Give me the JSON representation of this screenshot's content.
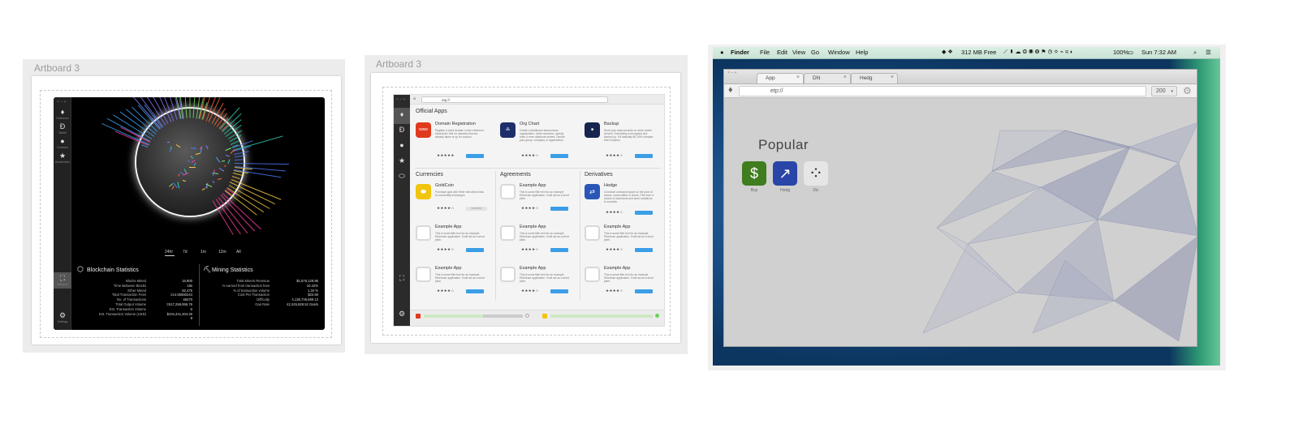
{
  "artboard1": {
    "title": "Artboard 3",
    "sidebar": [
      {
        "icon": "ethereum-icon",
        "glyph": "♦",
        "label": "Ethereum"
      },
      {
        "icon": "wallet-icon",
        "glyph": "Ð",
        "label": "Wallet"
      },
      {
        "icon": "contacts-icon",
        "glyph": "●",
        "label": "Contacts"
      },
      {
        "icon": "star-icon",
        "glyph": "★",
        "label": "Bookmarks"
      }
    ],
    "sidebar_bottom": [
      {
        "icon": "network-icon",
        "glyph": "⛶",
        "label": "Network"
      },
      {
        "icon": "gear-icon",
        "glyph": "⚙",
        "label": "Settings"
      }
    ],
    "ranges": [
      "24hr",
      "7d",
      "1m",
      "12m",
      "All"
    ],
    "blockchain": {
      "heading": "Blockchain Statistics",
      "rows": [
        {
          "label": "Blocks Mined",
          "value": "15,900"
        },
        {
          "label": "Time Between Blocks",
          "value": "18s"
        },
        {
          "label": "Ether Mined",
          "value": "82,475"
        },
        {
          "label": "Total Transaction Fees",
          "value": "Ξ14.55550244"
        },
        {
          "label": "No. of Transactions",
          "value": "48470"
        },
        {
          "label": "Total Output Volume",
          "value": "Ξ517,258,955.76"
        },
        {
          "label": "Est. Transaction Volume",
          "value": "6"
        },
        {
          "label": "Est. Transaction Volume (USD)",
          "value": "$104,441,404.26"
        },
        {
          "label": "",
          "value": "8"
        }
      ]
    },
    "mining": {
      "heading": "Mining Statistics",
      "rows": [
        {
          "label": "Total Miners Revenue",
          "value": "$1,576,128.86"
        },
        {
          "label": "% earned from transaction fees",
          "value": "10.42%"
        },
        {
          "label": "% of transaction volume",
          "value": "1.34 %"
        },
        {
          "label": "Cost Per Transaction",
          "value": "$22.69"
        },
        {
          "label": "Difficulty",
          "value": "4,138,736,689.13"
        },
        {
          "label": "Gas Rate",
          "value": "42,245,828.52 Gas/s"
        }
      ]
    }
  },
  "artboard2": {
    "title": "Artboard 3",
    "url": "etp://",
    "official_heading": "Official Apps",
    "official_apps": [
      {
        "name": "Domain Registration",
        "icon_text": "www",
        "color": "#e03a1e",
        "desc": "Register a short domain on the ethereum blockchain. Bid for domains that are already taken or up for auction.",
        "stars": "★★★★★"
      },
      {
        "name": "Org Chart",
        "icon_text": "⁂",
        "color": "#1d2f6b",
        "desc": "Create a distributed autonomous organization. Invite members, specify roles & even distribute shares. Decide your group, company or organization.",
        "stars": "★★★★☆"
      },
      {
        "name": "Backup",
        "icon_text": "■",
        "color": "#16244e",
        "desc": "Store your data securely on other nodes' servers. Everything is encrypted and backed up. It's basically 80–90% cheaper than Dropbox.",
        "stars": "★★★★☆"
      }
    ],
    "columns": [
      {
        "heading": "Currencies",
        "apps": [
          {
            "name": "GoldCoin",
            "color": "#f1c40f",
            "desc": "Purchase gold with Ether with direct links to commodity exchanges.",
            "stars": "★★★★☆",
            "button": "Installed"
          },
          {
            "name": "Example App",
            "color": "",
            "desc": "This is some filler text for an example Ethereum application. It will act as a short pitch.",
            "stars": "★★★★☆",
            "button": ""
          },
          {
            "name": "Example App",
            "color": "",
            "desc": "This is some filler text for an example Ethereum application. It will act as a short pitch.",
            "stars": "★★★★☆",
            "button": ""
          }
        ]
      },
      {
        "heading": "Agreements",
        "apps": [
          {
            "name": "Example App",
            "color": "",
            "desc": "This is some filler text for an example Ethereum application. It will act as a short pitch.",
            "stars": "★★★★☆",
            "button": ""
          },
          {
            "name": "Example App",
            "color": "",
            "desc": "This is some filler text for an example Ethereum application. It will act as a short pitch.",
            "stars": "★★★★☆",
            "button": ""
          },
          {
            "name": "Example App",
            "color": "",
            "desc": "This is some filler text for an example Ethereum application. It will act as a short pitch.",
            "stars": "★★★★☆",
            "button": ""
          }
        ]
      },
      {
        "heading": "Derivatives",
        "apps": [
          {
            "name": "Hedge",
            "color": "#2a56b8",
            "desc": "Construct contracts based on the price of stocks, commodities & bonds. Pick from a choice of data feeds and send invitations to contacts.",
            "stars": "★★★★☆",
            "button": ""
          },
          {
            "name": "Example App",
            "color": "",
            "desc": "This is some filler text for an example Ethereum application. It will act as a short pitch.",
            "stars": "★★★★☆",
            "button": ""
          },
          {
            "name": "Example App",
            "color": "",
            "desc": "This is some filler text for an example Ethereum application. It will act as a short pitch.",
            "stars": "★★★★☆",
            "button": ""
          }
        ]
      }
    ]
  },
  "artboard3": {
    "menubar": {
      "apple": "",
      "items": [
        "Finder",
        "File",
        "Edit",
        "View",
        "Go",
        "Window",
        "Help"
      ],
      "free": "312 MB Free",
      "battery": "100%",
      "clock": "Sun 7:32 AM"
    },
    "tabs": [
      {
        "label": "App",
        "active": true
      },
      {
        "label": "DN",
        "active": false
      },
      {
        "label": "Hedg",
        "active": false
      }
    ],
    "url": "etp://",
    "select_value": "200",
    "popular_heading": "Popular",
    "popular_apps": [
      {
        "label": "Buy",
        "glyph": "$",
        "color": "#3f7d1f"
      },
      {
        "label": "Hedg",
        "glyph": "↗",
        "color": "#2a45a8"
      },
      {
        "label": "Dic",
        "glyph": "⁘",
        "color": "#e6e6e6"
      }
    ]
  }
}
